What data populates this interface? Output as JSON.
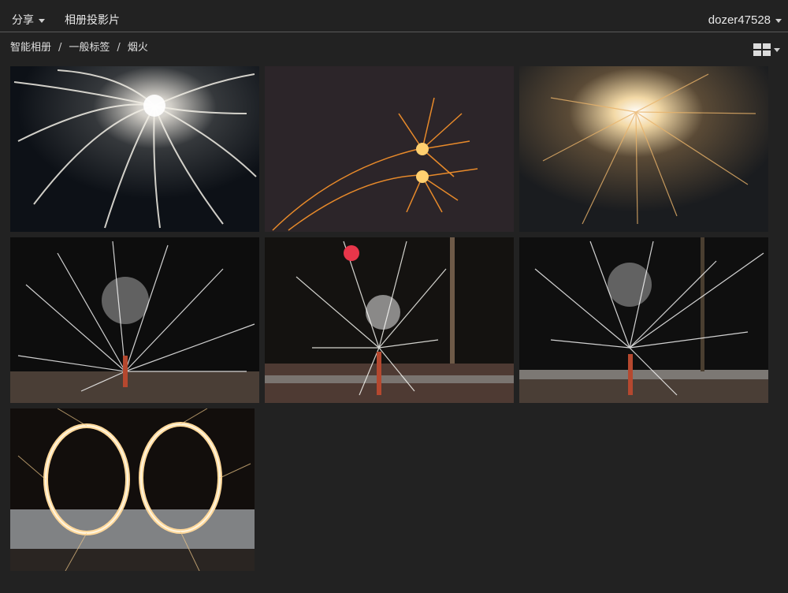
{
  "topbar": {
    "share_label": "分享",
    "slideshow_label": "相册投影片",
    "username": "dozer47528"
  },
  "breadcrumb": {
    "items": [
      "智能相册",
      "一般标签",
      "烟火"
    ],
    "separator": "/"
  },
  "colors": {
    "background": "#222222",
    "text": "#e6e6e6",
    "divider": "#5a5a5a"
  },
  "photos": [
    {
      "id": 1,
      "subject": "white firework burst in night sky"
    },
    {
      "id": 2,
      "subject": "orange firework sparks"
    },
    {
      "id": 3,
      "subject": "glowing golden spark burst"
    },
    {
      "id": 4,
      "subject": "ground fountain firework"
    },
    {
      "id": 5,
      "subject": "ground fountain firework with colored sparks"
    },
    {
      "id": 6,
      "subject": "ground fountain firework by trees"
    },
    {
      "id": 7,
      "subject": "sparkler light painting of two rings"
    }
  ]
}
